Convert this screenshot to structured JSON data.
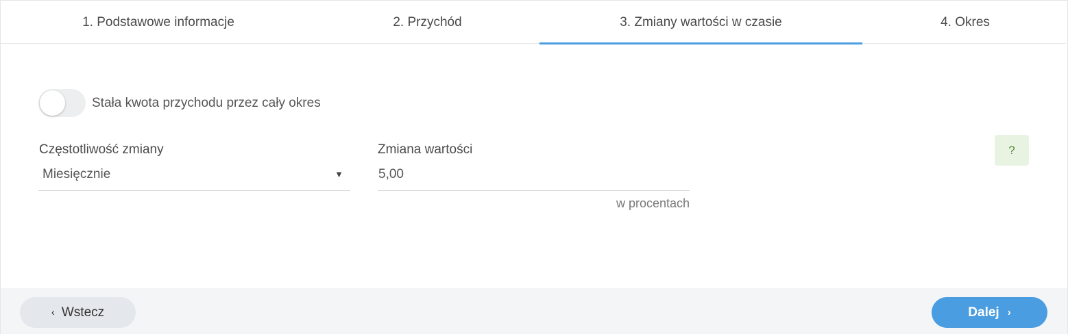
{
  "tabs": [
    {
      "label": "1. Podstawowe informacje"
    },
    {
      "label": "2. Przychód"
    },
    {
      "label": "3. Zmiany wartości w czasie",
      "active": true
    },
    {
      "label": "4. Okres"
    }
  ],
  "toggle": {
    "label": "Stała kwota przychodu przez cały okres",
    "checked": false
  },
  "frequency": {
    "label": "Częstotliwość zmiany",
    "value": "Miesięcznie",
    "arrow": "▼"
  },
  "change": {
    "label": "Zmiana wartości",
    "value": "5,00",
    "hint": "w procentach"
  },
  "help": {
    "label": "?"
  },
  "footer": {
    "back_label": "Wstecz",
    "next_label": "Dalej",
    "back_icon": "‹",
    "next_icon": "›"
  },
  "colors": {
    "accent": "#4a9de0",
    "help_bg": "#e8f4e1"
  }
}
